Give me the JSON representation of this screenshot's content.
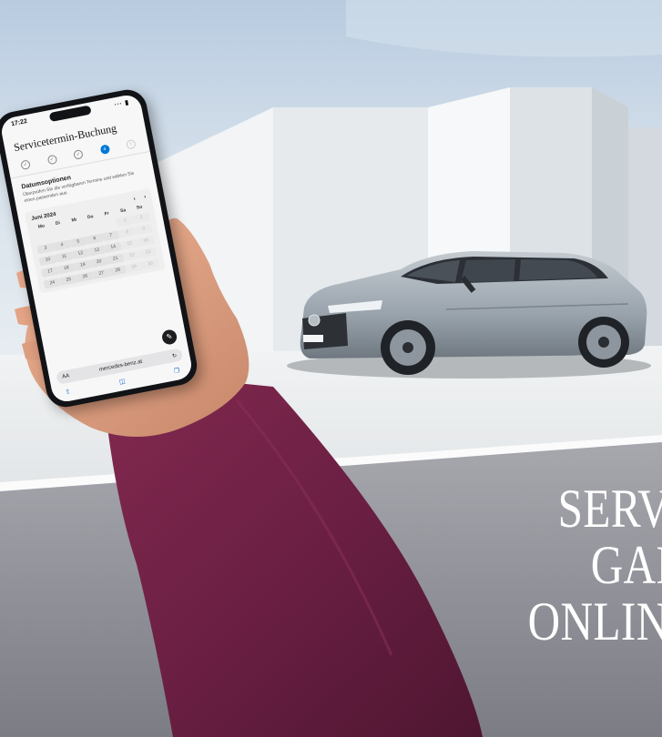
{
  "headline": {
    "line1": "SERVICET",
    "line2": "GANZ EI",
    "line3": "ONLINE BU"
  },
  "phone": {
    "time": "17:22",
    "signal": "∙∙∙ ▮",
    "title": "Servicetermin-Buchung",
    "steps": [
      "✓",
      "✓",
      "✓",
      "4",
      "5"
    ],
    "section_title": "Datumsoptionen",
    "section_desc": "Überprüfen Sie die verfügbaren Termine und wählen Sie einen passenden aus.",
    "month": "Juni 2024",
    "nav_prev": "‹",
    "nav_next": "›",
    "weekdays": [
      "Mo",
      "Di",
      "Mi",
      "Do",
      "Fr",
      "Sa",
      "So"
    ],
    "days": [
      "",
      "",
      "",
      "",
      "",
      "1",
      "2",
      "3",
      "4",
      "5",
      "6",
      "7",
      "8",
      "9",
      "10",
      "11",
      "12",
      "13",
      "14",
      "15",
      "16",
      "17",
      "18",
      "19",
      "20",
      "21",
      "22",
      "23",
      "24",
      "25",
      "26",
      "27",
      "28",
      "29",
      "30"
    ],
    "url": "mercedes-benz.at",
    "url_prefix": "AA",
    "reload_icon": "reload-icon",
    "chat_icon": "chat-icon"
  },
  "colors": {
    "accent": "#0078d6",
    "sleeve": "#6e1f45",
    "car": "#a7b0b8"
  }
}
